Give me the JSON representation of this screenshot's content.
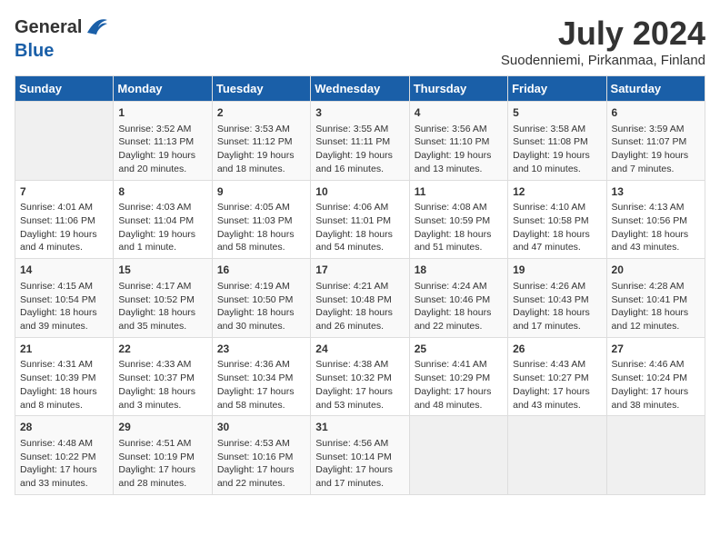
{
  "header": {
    "logo_general": "General",
    "logo_blue": "Blue",
    "month_year": "July 2024",
    "location": "Suodenniemi, Pirkanmaa, Finland"
  },
  "weekdays": [
    "Sunday",
    "Monday",
    "Tuesday",
    "Wednesday",
    "Thursday",
    "Friday",
    "Saturday"
  ],
  "weeks": [
    [
      {
        "day": "",
        "info": ""
      },
      {
        "day": "1",
        "info": "Sunrise: 3:52 AM\nSunset: 11:13 PM\nDaylight: 19 hours\nand 20 minutes."
      },
      {
        "day": "2",
        "info": "Sunrise: 3:53 AM\nSunset: 11:12 PM\nDaylight: 19 hours\nand 18 minutes."
      },
      {
        "day": "3",
        "info": "Sunrise: 3:55 AM\nSunset: 11:11 PM\nDaylight: 19 hours\nand 16 minutes."
      },
      {
        "day": "4",
        "info": "Sunrise: 3:56 AM\nSunset: 11:10 PM\nDaylight: 19 hours\nand 13 minutes."
      },
      {
        "day": "5",
        "info": "Sunrise: 3:58 AM\nSunset: 11:08 PM\nDaylight: 19 hours\nand 10 minutes."
      },
      {
        "day": "6",
        "info": "Sunrise: 3:59 AM\nSunset: 11:07 PM\nDaylight: 19 hours\nand 7 minutes."
      }
    ],
    [
      {
        "day": "7",
        "info": "Sunrise: 4:01 AM\nSunset: 11:06 PM\nDaylight: 19 hours\nand 4 minutes."
      },
      {
        "day": "8",
        "info": "Sunrise: 4:03 AM\nSunset: 11:04 PM\nDaylight: 19 hours\nand 1 minute."
      },
      {
        "day": "9",
        "info": "Sunrise: 4:05 AM\nSunset: 11:03 PM\nDaylight: 18 hours\nand 58 minutes."
      },
      {
        "day": "10",
        "info": "Sunrise: 4:06 AM\nSunset: 11:01 PM\nDaylight: 18 hours\nand 54 minutes."
      },
      {
        "day": "11",
        "info": "Sunrise: 4:08 AM\nSunset: 10:59 PM\nDaylight: 18 hours\nand 51 minutes."
      },
      {
        "day": "12",
        "info": "Sunrise: 4:10 AM\nSunset: 10:58 PM\nDaylight: 18 hours\nand 47 minutes."
      },
      {
        "day": "13",
        "info": "Sunrise: 4:13 AM\nSunset: 10:56 PM\nDaylight: 18 hours\nand 43 minutes."
      }
    ],
    [
      {
        "day": "14",
        "info": "Sunrise: 4:15 AM\nSunset: 10:54 PM\nDaylight: 18 hours\nand 39 minutes."
      },
      {
        "day": "15",
        "info": "Sunrise: 4:17 AM\nSunset: 10:52 PM\nDaylight: 18 hours\nand 35 minutes."
      },
      {
        "day": "16",
        "info": "Sunrise: 4:19 AM\nSunset: 10:50 PM\nDaylight: 18 hours\nand 30 minutes."
      },
      {
        "day": "17",
        "info": "Sunrise: 4:21 AM\nSunset: 10:48 PM\nDaylight: 18 hours\nand 26 minutes."
      },
      {
        "day": "18",
        "info": "Sunrise: 4:24 AM\nSunset: 10:46 PM\nDaylight: 18 hours\nand 22 minutes."
      },
      {
        "day": "19",
        "info": "Sunrise: 4:26 AM\nSunset: 10:43 PM\nDaylight: 18 hours\nand 17 minutes."
      },
      {
        "day": "20",
        "info": "Sunrise: 4:28 AM\nSunset: 10:41 PM\nDaylight: 18 hours\nand 12 minutes."
      }
    ],
    [
      {
        "day": "21",
        "info": "Sunrise: 4:31 AM\nSunset: 10:39 PM\nDaylight: 18 hours\nand 8 minutes."
      },
      {
        "day": "22",
        "info": "Sunrise: 4:33 AM\nSunset: 10:37 PM\nDaylight: 18 hours\nand 3 minutes."
      },
      {
        "day": "23",
        "info": "Sunrise: 4:36 AM\nSunset: 10:34 PM\nDaylight: 17 hours\nand 58 minutes."
      },
      {
        "day": "24",
        "info": "Sunrise: 4:38 AM\nSunset: 10:32 PM\nDaylight: 17 hours\nand 53 minutes."
      },
      {
        "day": "25",
        "info": "Sunrise: 4:41 AM\nSunset: 10:29 PM\nDaylight: 17 hours\nand 48 minutes."
      },
      {
        "day": "26",
        "info": "Sunrise: 4:43 AM\nSunset: 10:27 PM\nDaylight: 17 hours\nand 43 minutes."
      },
      {
        "day": "27",
        "info": "Sunrise: 4:46 AM\nSunset: 10:24 PM\nDaylight: 17 hours\nand 38 minutes."
      }
    ],
    [
      {
        "day": "28",
        "info": "Sunrise: 4:48 AM\nSunset: 10:22 PM\nDaylight: 17 hours\nand 33 minutes."
      },
      {
        "day": "29",
        "info": "Sunrise: 4:51 AM\nSunset: 10:19 PM\nDaylight: 17 hours\nand 28 minutes."
      },
      {
        "day": "30",
        "info": "Sunrise: 4:53 AM\nSunset: 10:16 PM\nDaylight: 17 hours\nand 22 minutes."
      },
      {
        "day": "31",
        "info": "Sunrise: 4:56 AM\nSunset: 10:14 PM\nDaylight: 17 hours\nand 17 minutes."
      },
      {
        "day": "",
        "info": ""
      },
      {
        "day": "",
        "info": ""
      },
      {
        "day": "",
        "info": ""
      }
    ]
  ]
}
